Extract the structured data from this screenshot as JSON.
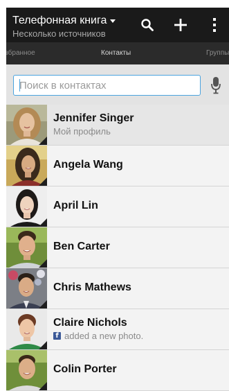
{
  "header": {
    "title": "Телефонная книга",
    "subtitle": "Несколько источников",
    "dropdown_icon": "caret-down-icon",
    "actions": [
      "search-icon",
      "add-icon",
      "more-vert-icon"
    ]
  },
  "tabs": {
    "left": "Избранное",
    "center": "Контакты",
    "right": "Группы"
  },
  "search": {
    "placeholder": "Поиск в контактах",
    "value": "",
    "voice_icon": "microphone-icon"
  },
  "colors": {
    "action_bar": "#1a1a1a",
    "tab_bar": "#2b2b2b",
    "accent": "#4aa3df",
    "facebook": "#3b5998"
  },
  "contacts": [
    {
      "name": "Jennifer Singer",
      "subtitle": "Мой профиль",
      "self": true
    },
    {
      "name": "Angela Wang"
    },
    {
      "name": "April Lin"
    },
    {
      "name": "Ben Carter"
    },
    {
      "name": "Chris Mathews"
    },
    {
      "name": "Claire Nichols",
      "subtitle": "added a new photo.",
      "subtitle_icon": "facebook-icon"
    },
    {
      "name": "Colin Porter"
    }
  ]
}
